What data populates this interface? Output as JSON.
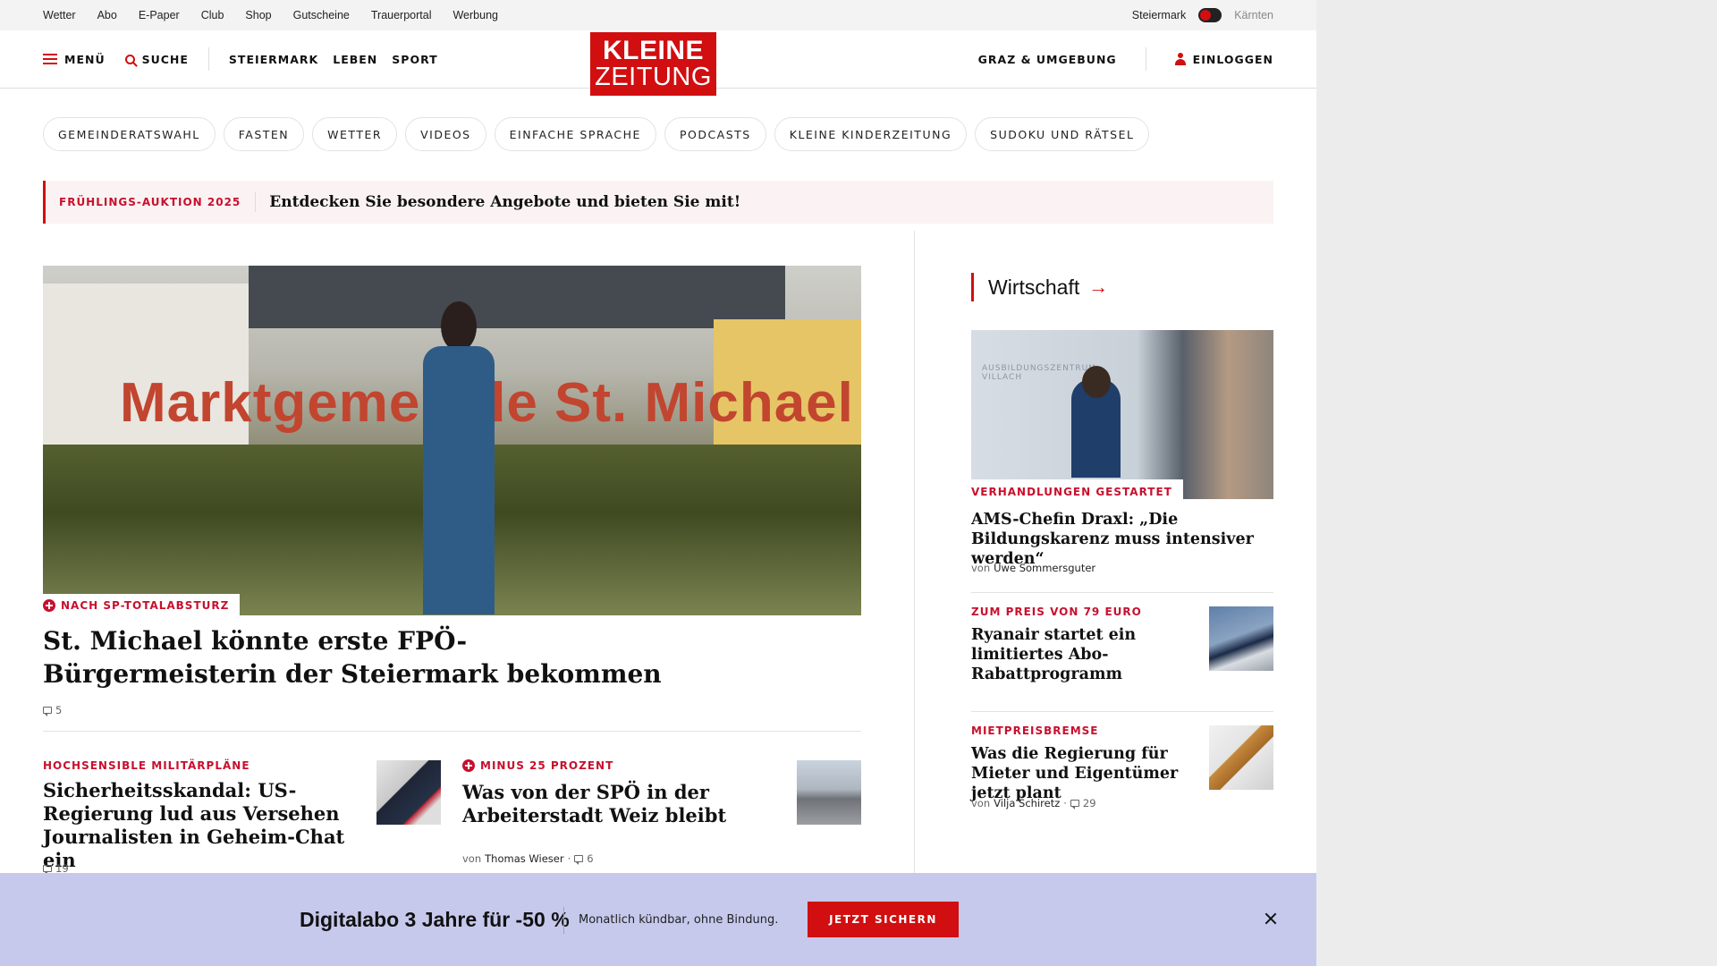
{
  "topbar": {
    "links": [
      "Wetter",
      "Abo",
      "E-Paper",
      "Club",
      "Shop",
      "Gutscheine",
      "Trauerportal",
      "Werbung"
    ],
    "region_active": "Steiermark",
    "region_inactive": "Kärnten"
  },
  "nav": {
    "menu_label": "MENÜ",
    "search_label": "SUCHE",
    "sections": [
      "STEIERMARK",
      "LEBEN",
      "SPORT"
    ],
    "logo_line1": "KLEINE",
    "logo_line2": "ZEITUNG",
    "region_link": "GRAZ & UMGEBUNG",
    "login_label": "EINLOGGEN"
  },
  "pills": [
    "GEMEINDERATSWAHL",
    "FASTEN",
    "WETTER",
    "VIDEOS",
    "EINFACHE SPRACHE",
    "PODCASTS",
    "KLEINE KINDERZEITUNG",
    "SUDOKU UND RÄTSEL"
  ],
  "promo": {
    "kicker": "FRÜHLINGS-AUKTION 2025",
    "text": "Entdecken Sie besondere Angebote und bieten Sie mit!"
  },
  "hero": {
    "image_text": "Marktgemeinde St. Michael",
    "kicker": "NACH SP-TOTALABSTURZ",
    "headline": "St. Michael könnte erste FPÖ-Bürgermeisterin der Steiermark bekommen",
    "comments": "5"
  },
  "articles": [
    {
      "kicker": "HOCHSENSIBLE MILITÄRPLÄNE",
      "headline": "Sicherheitsskandal: US-Regierung lud aus Versehen Journalisten in Geheim-Chat ein",
      "comments": "19"
    },
    {
      "kicker": "MINUS 25 PROZENT",
      "headline": "Was von der SPÖ in der Arbeiterstadt Weiz bleibt",
      "by": "von",
      "author": "Thomas Wieser",
      "comments": "6"
    }
  ],
  "sidebar": {
    "section_title": "Wirtschaft",
    "items": [
      {
        "kicker": "VERHANDLUNGEN GESTARTET",
        "headline": "AMS-Chefin Draxl: „Die Bildungskarenz muss intensiver werden“",
        "image_text": "AUSBILDUNGSZENTRUM VILLACH",
        "by": "von",
        "author": "Uwe Sommersguter"
      },
      {
        "kicker": "ZUM PREIS VON 79 EURO",
        "headline": "Ryanair startet ein limitiertes Abo-Rabattprogramm"
      },
      {
        "kicker": "MIETPREISBREMSE",
        "headline": "Was die Regierung für Mieter und Eigentümer jetzt plant",
        "by": "von",
        "author": "Vilja Schiretz",
        "comments": "29"
      }
    ]
  },
  "banner": {
    "headline": "Digitalabo 3 Jahre für -50 %",
    "subtext": "Monatlich kündbar, ohne Bindung.",
    "cta": "JETZT SICHERN"
  },
  "colors": {
    "brand_red": "#d10e10",
    "kicker_red": "#c8102e",
    "banner_bg": "#c6c9ec",
    "promo_bg": "#fbf3f3"
  }
}
